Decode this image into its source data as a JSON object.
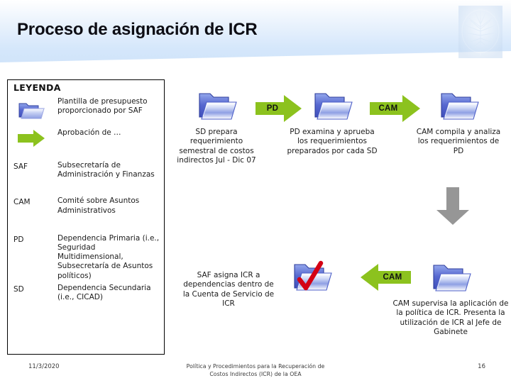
{
  "header": {
    "title": "Proceso de asignación de ICR",
    "emblem_name": "oea-tree-emblem",
    "gradient_top": "#ffffff",
    "gradient_bottom": "#cfe3fa"
  },
  "legend": {
    "title": "LEYENDA",
    "rows": [
      {
        "key": "",
        "icon": "folder-icon",
        "desc": "Plantilla de presupuesto proporcionado por SAF"
      },
      {
        "key": "",
        "icon": "green-arrow-icon",
        "desc": "Aprobación de …"
      },
      {
        "key": "SAF",
        "icon": "",
        "desc": "Subsecretaría de Administración y Finanzas"
      },
      {
        "key": "CAM",
        "icon": "",
        "desc": "Comité sobre Asuntos Administrativos"
      },
      {
        "key": "PD",
        "icon": "",
        "desc": "Dependencia Primaria (i.e., Seguridad Multidimensional, Subsecretaría de Asuntos políticos)"
      },
      {
        "key": "SD",
        "icon": "",
        "desc": "Dependencia Secundaria (i.e., CICAD)"
      }
    ]
  },
  "flow": {
    "nodes": [
      {
        "id": "sd-prepara",
        "icon": "folder-icon",
        "caption": "SD prepara requerimiento semestral de costos indirectos Jul - Dic 07"
      },
      {
        "id": "pd-examina",
        "icon": "folder-icon",
        "caption": "PD examina y aprueba los requerimientos preparados por cada SD"
      },
      {
        "id": "cam-compila",
        "icon": "folder-icon",
        "caption": "CAM compila y analiza los requerimientos de PD"
      },
      {
        "id": "saf-asigna",
        "icon": "folder-check-icon",
        "caption": "SAF asigna ICR a dependencias dentro de la Cuenta de Servicio de ICR"
      },
      {
        "id": "cam-supervisa",
        "icon": "folder-icon",
        "caption": "CAM supervisa la aplicación de la política de ICR. Presenta la utilización de ICR al Jefe de Gabinete"
      }
    ],
    "connectors": [
      {
        "id": "arrow-pd",
        "label": "PD",
        "direction": "right",
        "color": "#8cc21e"
      },
      {
        "id": "arrow-cam-right",
        "label": "CAM",
        "direction": "right",
        "color": "#8cc21e"
      },
      {
        "id": "arrow-down",
        "label": "",
        "direction": "down",
        "color": "#969696"
      },
      {
        "id": "arrow-cam-left",
        "label": "CAM",
        "direction": "left",
        "color": "#8cc21e"
      }
    ]
  },
  "footer": {
    "date": "11/3/2020",
    "center_line1": "Política y Procedimientos para la Recuperación de",
    "center_line2": "Costos Indirectos (ICR) de la OEA",
    "page": "16"
  }
}
